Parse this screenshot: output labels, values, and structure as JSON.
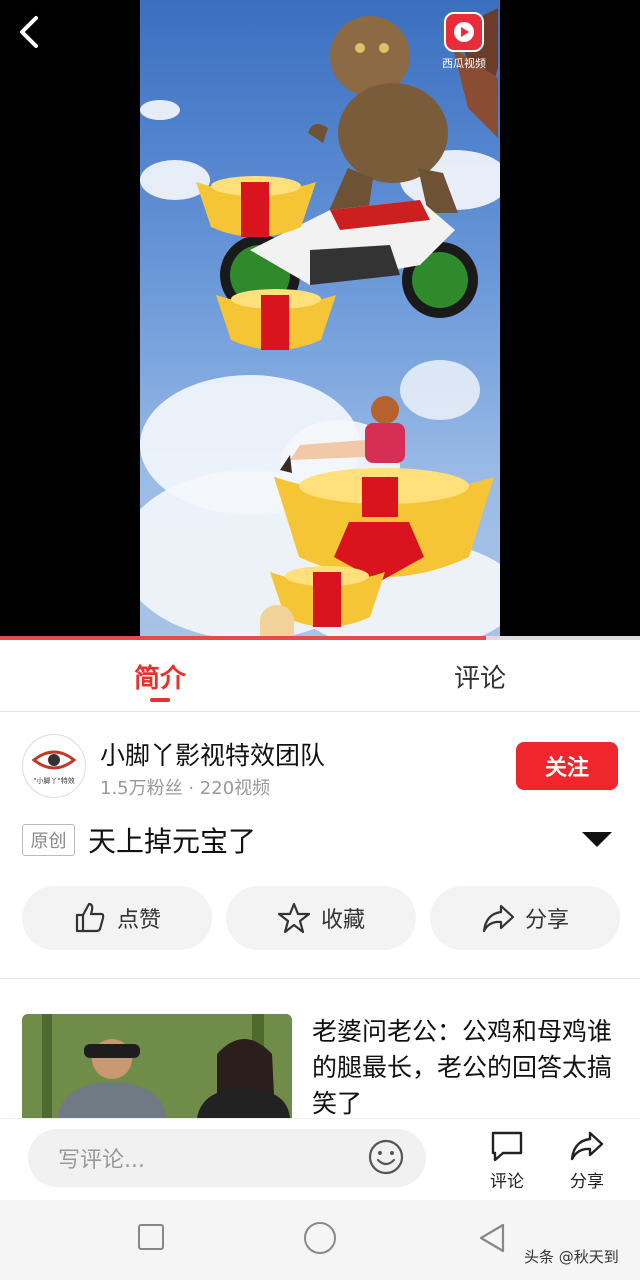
{
  "video": {
    "brand_logo_text": "西瓜视频",
    "progress_percent": 76
  },
  "tabs": {
    "intro": "简介",
    "comments": "评论"
  },
  "author": {
    "name": "小脚丫影视特效团队",
    "meta": "1.5万粉丝 · 220视频",
    "follow_label": "关注",
    "avatar_text": "\"小脚丫\"特效"
  },
  "video_info": {
    "badge": "原创",
    "title": "天上掉元宝了"
  },
  "actions": {
    "like": "点赞",
    "favorite": "收藏",
    "share": "分享"
  },
  "recommended": {
    "title": "老婆问老公：公鸡和母鸡谁的腿最长，老公的回答太搞笑了"
  },
  "comment_bar": {
    "placeholder": "写评论...",
    "comment_label": "评论",
    "share_label": "分享"
  },
  "watermark": "头条 @秋天到",
  "colors": {
    "accent": "#e5322d",
    "follow": "#f0262d"
  }
}
